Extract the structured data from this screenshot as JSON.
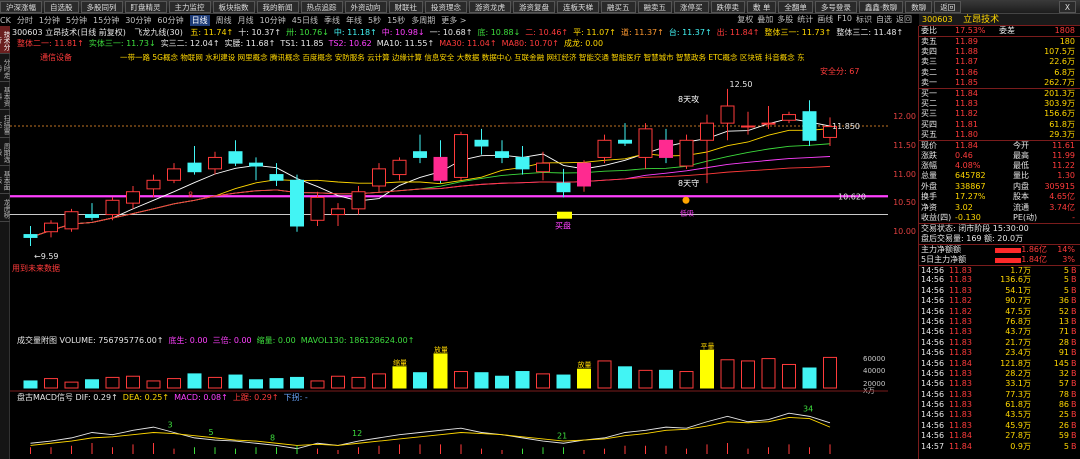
{
  "topbar": {
    "buttons": [
      "沪深涨幅",
      "自选股",
      "多股同列",
      "盯盘精灵",
      "主力监控",
      "板块指数",
      "我的新闻",
      "热点追踪",
      "外资动向",
      "财联社",
      "投资理念",
      "游资龙虎",
      "游资复盘",
      "连板天梯",
      "融买五",
      "融卖五",
      "涨停买",
      "跌停卖",
      "敷 单",
      "全翻单",
      "多号登录",
      "鑫鑫·数聊",
      "数聊",
      "返回"
    ],
    "close": "X"
  },
  "periodbar": {
    "items": [
      "CK",
      "分时",
      "1分钟",
      "5分钟",
      "15分钟",
      "30分钟",
      "60分钟",
      "日线",
      "周线",
      "月线",
      "10分钟",
      "45日线",
      "季线",
      "年线",
      "5秒",
      "15秒",
      "多周期",
      "更多 >"
    ],
    "active": "日线",
    "right": [
      "复权",
      "叠加",
      "多股",
      "统计",
      "画线",
      "F10",
      "标识",
      "自选",
      "返回"
    ]
  },
  "sidebar": {
    "tabs": [
      "技术分析",
      "分时走势",
      "基本资料",
      "扫描雷达",
      "周期选股",
      "基本面板",
      "龙虎榜"
    ],
    "active": "技术分析"
  },
  "chart": {
    "title": "300603 立昂技术(日线 前复权)",
    "indicator": "飞龙九线(30)",
    "ma_values": [
      {
        "t": "五: 11.74↑",
        "c": "y"
      },
      {
        "t": "十: 10.37↑",
        "c": "w"
      },
      {
        "t": "卅: 10.76↓",
        "c": "g"
      },
      {
        "t": "中: 11.18↑",
        "c": "c"
      },
      {
        "t": "中: 10.98↓",
        "c": "m"
      },
      {
        "t": "一: 10.68↑",
        "c": "w"
      },
      {
        "t": "底: 10.88↓",
        "c": "g"
      },
      {
        "t": "二: 10.46↑",
        "c": "r"
      },
      {
        "t": "平: 11.07↑",
        "c": "y"
      },
      {
        "t": "道: 11.37↑",
        "c": "o"
      },
      {
        "t": "台: 11.37↑",
        "c": "c"
      },
      {
        "t": "出: 11.84↑",
        "c": "r"
      },
      {
        "t": "整体三一: 11.73↑",
        "c": "y"
      },
      {
        "t": "整体三二: 11.48↑",
        "c": "w"
      }
    ],
    "line3": [
      {
        "t": "整体二一: 11.81↑",
        "c": "r"
      },
      {
        "t": "实体三一: 11.73↓",
        "c": "g"
      },
      {
        "t": "实三二: 12.04↑",
        "c": "w"
      },
      {
        "t": "实腰: 11.68↑",
        "c": "w"
      },
      {
        "t": "TS1: 11.85",
        "c": "w"
      },
      {
        "t": "TS2: 10.62",
        "c": "m"
      },
      {
        "t": "MA10: 11.55↑",
        "c": "w"
      },
      {
        "t": "MA30: 11.04↑",
        "c": "r"
      },
      {
        "t": "MA80: 10.70↑",
        "c": "r"
      },
      {
        "t": "成龙: 0.00",
        "c": "y"
      }
    ],
    "concepts_label": "通信设备",
    "concepts": "一带一路 5G概念 物联网 水利建设 网里概念 腾讯概念 百度概念 安防服务 云计算 边缘计算 信息安全 大数据 数据中心 互联金融 网红经济 智能交通 智能医疗 智慧城市 智慧政务 ETC概念 区块链 抖音概念 东",
    "safe_label": "安全分: 67",
    "annotations": {
      "high": "12.50",
      "low": "9.59",
      "right_high": "11.850",
      "right_low": "10.620",
      "attack": "8天攻",
      "guard": "8天守",
      "buy": "买盘",
      "red8": "8",
      "bottom": "低吸"
    },
    "price_axis": [
      "12.00",
      "11.50",
      "11.00",
      "10.50",
      "10.00"
    ],
    "future": "用到未来数据"
  },
  "chart_data": [
    {
      "type": "candlestick",
      "title": "300603 立昂技术(日线 前复权)",
      "ohlc": [
        [
          9.95,
          10.1,
          9.75,
          9.9
        ],
        [
          10.0,
          10.2,
          9.9,
          10.15
        ],
        [
          10.05,
          10.4,
          10.0,
          10.35
        ],
        [
          10.3,
          10.5,
          10.2,
          10.25
        ],
        [
          10.3,
          10.6,
          10.2,
          10.55
        ],
        [
          10.5,
          10.8,
          10.4,
          10.7
        ],
        [
          10.75,
          11.0,
          10.6,
          10.9
        ],
        [
          10.9,
          11.2,
          10.85,
          11.1
        ],
        [
          11.2,
          11.5,
          11.0,
          11.05
        ],
        [
          11.1,
          11.4,
          11.0,
          11.3
        ],
        [
          11.4,
          11.6,
          11.15,
          11.2
        ],
        [
          11.2,
          11.3,
          10.9,
          11.15
        ],
        [
          11.0,
          11.2,
          10.8,
          10.9
        ],
        [
          10.9,
          11.0,
          10.0,
          10.1
        ],
        [
          10.2,
          10.7,
          10.1,
          10.6
        ],
        [
          10.3,
          10.5,
          10.1,
          10.4
        ],
        [
          10.4,
          10.8,
          10.3,
          10.7
        ],
        [
          10.8,
          11.2,
          10.7,
          11.1
        ],
        [
          11.0,
          11.3,
          10.9,
          11.25
        ],
        [
          11.4,
          11.7,
          11.2,
          11.3
        ],
        [
          11.3,
          11.6,
          10.85,
          10.9
        ],
        [
          10.95,
          11.75,
          10.9,
          11.7
        ],
        [
          11.6,
          11.8,
          11.35,
          11.5
        ],
        [
          11.4,
          11.6,
          11.2,
          11.3
        ],
        [
          11.3,
          11.5,
          11.0,
          11.1
        ],
        [
          11.05,
          11.4,
          10.9,
          11.2
        ],
        [
          10.85,
          11.1,
          10.6,
          10.7
        ],
        [
          10.8,
          11.25,
          10.7,
          11.2
        ],
        [
          11.3,
          11.7,
          11.2,
          11.6
        ],
        [
          11.6,
          11.9,
          11.5,
          11.55
        ],
        [
          11.3,
          11.9,
          11.1,
          11.8
        ],
        [
          11.6,
          11.8,
          11.2,
          11.3
        ],
        [
          11.15,
          11.7,
          11.1,
          11.6
        ],
        [
          11.6,
          12.05,
          10.85,
          11.9
        ],
        [
          11.9,
          12.5,
          11.6,
          12.2
        ],
        [
          11.85,
          12.1,
          11.7,
          11.85
        ],
        [
          11.9,
          12.2,
          11.8,
          11.9
        ],
        [
          11.95,
          12.1,
          11.9,
          12.05
        ],
        [
          12.1,
          12.3,
          11.5,
          11.6
        ],
        [
          11.65,
          12.0,
          11.5,
          11.84
        ]
      ]
    },
    {
      "type": "bar",
      "title": "成交量附图 VOLUME",
      "ylabel": "X万",
      "values": [
        6,
        8,
        5,
        7,
        9,
        10,
        6,
        8,
        12,
        9,
        11,
        7,
        8,
        9,
        6,
        10,
        9,
        12,
        18,
        13,
        29,
        14,
        13,
        10,
        14,
        12,
        11,
        16,
        23,
        18,
        15,
        15,
        14,
        32,
        24,
        23,
        25,
        20,
        17,
        26
      ]
    },
    {
      "type": "line",
      "title": "盘古MACD信号",
      "series": [
        {
          "name": "DIF",
          "values": [
            0.1,
            0.12,
            0.15,
            0.2,
            0.18,
            0.22,
            0.25,
            0.2,
            0.15,
            0.13,
            0.12,
            0.1,
            0.08,
            0.05,
            0.1,
            0.08,
            0.12,
            0.15,
            0.18,
            0.2,
            0.22,
            0.24,
            0.2,
            0.18,
            0.15,
            0.12,
            0.1,
            0.13,
            0.15,
            0.2,
            0.22,
            0.25,
            0.24,
            0.3,
            0.35,
            0.3,
            0.32,
            0.38,
            0.35,
            0.29
          ]
        },
        {
          "name": "DEA",
          "values": [
            0.08,
            0.1,
            0.12,
            0.15,
            0.16,
            0.18,
            0.2,
            0.19,
            0.17,
            0.15,
            0.13,
            0.12,
            0.1,
            0.08,
            0.09,
            0.08,
            0.1,
            0.12,
            0.14,
            0.16,
            0.18,
            0.2,
            0.19,
            0.18,
            0.16,
            0.14,
            0.12,
            0.13,
            0.14,
            0.17,
            0.19,
            0.22,
            0.23,
            0.26,
            0.3,
            0.29,
            0.3,
            0.34,
            0.33,
            0.25
          ]
        }
      ]
    }
  ],
  "vol_legend": [
    {
      "t": "成交量附图 VOLUME: 756795776.00↑",
      "c": "w"
    },
    {
      "t": "底生: 0.00",
      "c": "m"
    },
    {
      "t": "三倍: 0.00",
      "c": "m"
    },
    {
      "t": "缩量: 0.00",
      "c": "g"
    },
    {
      "t": "MAVOL130: 186128624.00↑",
      "c": "g"
    }
  ],
  "vol_axis": [
    "60000",
    "40000",
    "20000",
    "X万"
  ],
  "vol_labels": [
    "缩量",
    "放量",
    "放量",
    "平量"
  ],
  "macd_legend": [
    {
      "t": "盘古MACD信号  DIF: 0.29↑",
      "c": "w"
    },
    {
      "t": "DEA: 0.25↑",
      "c": "y"
    },
    {
      "t": "MACD: 0.08↑",
      "c": "m"
    },
    {
      "t": "上踞: 0.29↑",
      "c": "r"
    },
    {
      "t": "下拐: -",
      "c": "b"
    }
  ],
  "macd_nums": [
    "3",
    "5",
    "8",
    "12",
    "21",
    "34"
  ],
  "panel": {
    "code": "300603",
    "name": "立昂技术",
    "bid_ratio": {
      "l": "委比",
      "v": "17.53%",
      "dl": "委差",
      "dv": "1808"
    },
    "asks": [
      [
        "卖五",
        "11.89",
        "180"
      ],
      [
        "卖四",
        "11.88",
        "107.5万"
      ],
      [
        "卖三",
        "11.87",
        "22.6万"
      ],
      [
        "卖二",
        "11.86",
        "6.8万"
      ],
      [
        "卖一",
        "11.85",
        "262.7万"
      ]
    ],
    "bids": [
      [
        "买一",
        "11.84",
        "201.3万"
      ],
      [
        "买二",
        "11.83",
        "303.9万"
      ],
      [
        "买三",
        "11.82",
        "156.6万"
      ],
      [
        "买四",
        "11.81",
        "61.8万"
      ],
      [
        "买五",
        "11.80",
        "29.3万"
      ]
    ],
    "stats": [
      [
        "现价",
        "11.84",
        "今开",
        "11.61"
      ],
      [
        "涨跌",
        "0.46",
        "最高",
        "11.99"
      ],
      [
        "涨幅",
        "4.08%",
        "最低",
        "11.22"
      ],
      [
        "总量",
        "645782",
        "量比",
        "1.30"
      ],
      [
        "外盘",
        "338867",
        "内盘",
        "305915"
      ],
      [
        "换手",
        "17.27%",
        "股本",
        "4.65亿"
      ],
      [
        "净资",
        "3.02",
        "流通",
        "3.74亿"
      ],
      [
        "收益(四)",
        "-0.130",
        "PE(动)",
        "-"
      ]
    ],
    "status": "交易状态: 闭市阶段 15:30:00",
    "after": "盘后交易量: 169 额: 20.0万",
    "flows": [
      [
        "主力净额额",
        "1.86亿",
        "14%"
      ],
      [
        "5日主力净额",
        "1.84亿",
        "3%"
      ]
    ],
    "ticks": [
      [
        "14:56",
        "11.83",
        "1.7万",
        "5"
      ],
      [
        "14:56",
        "11.83",
        "136.6万",
        "5"
      ],
      [
        "14:56",
        "11.83",
        "54.1万",
        "5"
      ],
      [
        "14:56",
        "11.82",
        "90.7万",
        "36"
      ],
      [
        "14:56",
        "11.82",
        "47.5万",
        "52"
      ],
      [
        "14:56",
        "11.83",
        "76.8万",
        "13"
      ],
      [
        "14:56",
        "11.83",
        "43.7万",
        "71"
      ],
      [
        "14:56",
        "11.83",
        "21.7万",
        "28"
      ],
      [
        "14:56",
        "11.83",
        "23.4万",
        "91"
      ],
      [
        "14:56",
        "11.84",
        "121.8万",
        "145"
      ],
      [
        "14:56",
        "11.83",
        "28.2万",
        "32"
      ],
      [
        "14:56",
        "11.83",
        "33.1万",
        "57"
      ],
      [
        "14:56",
        "11.83",
        "77.3万",
        "78"
      ],
      [
        "14:56",
        "11.83",
        "61.8万",
        "86"
      ],
      [
        "14:56",
        "11.83",
        "43.5万",
        "25"
      ],
      [
        "14:56",
        "11.83",
        "45.9万",
        "26"
      ],
      [
        "14:56",
        "11.84",
        "27.8万",
        "59"
      ],
      [
        "14:57",
        "11.84",
        "0.9万",
        "5"
      ]
    ]
  }
}
